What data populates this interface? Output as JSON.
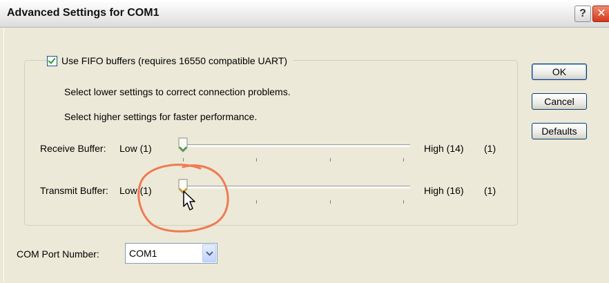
{
  "window": {
    "title": "Advanced Settings for COM1",
    "help_label": "?",
    "close_label": "✕"
  },
  "fifo": {
    "checkbox_label": "Use FIFO buffers (requires 16550 compatible UART)",
    "checked": true
  },
  "info": {
    "line1": "Select lower settings to correct connection problems.",
    "line2": "Select higher settings for faster performance."
  },
  "receive": {
    "label": "Receive Buffer:",
    "low": "Low (1)",
    "high": "High (14)",
    "value": "(1)"
  },
  "transmit": {
    "label": "Transmit Buffer:",
    "low": "Low (1)",
    "high": "High (16)",
    "value": "(1)"
  },
  "buttons": {
    "ok": "OK",
    "cancel": "Cancel",
    "defaults": "Defaults"
  },
  "port": {
    "label": "COM Port Number:",
    "selected": "COM1"
  },
  "colors": {
    "annotation": "#f07a52",
    "thumb_receive_accent": "#3c9a3c",
    "thumb_transmit_accent": "#e0a020"
  }
}
